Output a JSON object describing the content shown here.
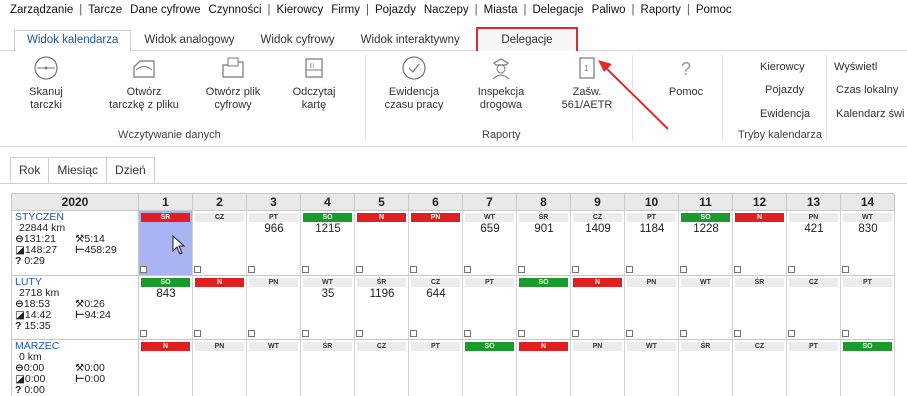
{
  "menubar": {
    "items": [
      "Zarządzanie",
      "Tarcze",
      "Dane cyfrowe",
      "Czynności",
      "Kierowcy",
      "Firmy",
      "Pojazdy",
      "Naczepy",
      "Miasta",
      "Delegacje",
      "Paliwo",
      "Raporty",
      "Pomoc"
    ]
  },
  "ribbon_tabs": [
    "Widok kalendarza",
    "Widok analogowy",
    "Widok cyfrowy",
    "Widok interaktywny",
    "Delegacje"
  ],
  "ribbon": {
    "buttons": [
      {
        "label1": "Skanuj",
        "label2": "tarczki",
        "icon": "scan-disc-icon"
      },
      {
        "label1": "Otwórz",
        "label2": "tarczkę z pliku",
        "icon": "open-disc-icon"
      },
      {
        "label1": "Otwórz plik",
        "label2": "cyfrowy",
        "icon": "open-file-icon"
      },
      {
        "label1": "Odczytaj",
        "label2": "kartę",
        "icon": "card-reader-icon"
      },
      {
        "label1": "Ewidencja",
        "label2": "czasu pracy",
        "icon": "clock-check-icon"
      },
      {
        "label1": "Inspekcja",
        "label2": "drogowa",
        "icon": "police-officer-icon"
      },
      {
        "label1": "Zašw.",
        "label2": "561/AETR",
        "icon": "document-1-icon"
      },
      {
        "label1": "Pomoc",
        "label2": "",
        "icon": "help-icon"
      }
    ],
    "groups": {
      "read": "Wczytywanie danych",
      "reports": "Raporty",
      "modes": "Tryby kalendarza"
    },
    "modes": [
      "Kierowcy",
      "Pojazdy",
      "Ewidencja"
    ],
    "display": [
      "Wyświetl",
      "Czas lokalny",
      "Kalendarz świ"
    ]
  },
  "view_tabs": [
    "Rok",
    "Miesiąc",
    "Dzień"
  ],
  "calendar": {
    "year": "2020",
    "days": [
      "1",
      "2",
      "3",
      "4",
      "5",
      "6",
      "7",
      "8",
      "9",
      "10",
      "11",
      "12",
      "13",
      "14"
    ],
    "months": [
      {
        "name": "STYCZEŃ",
        "km": "22844 km",
        "drive": "131:21",
        "work": "5:14",
        "other": "148:27",
        "rest": "458:29",
        "unknown": "0:29",
        "day_names": [
          "ŚR",
          "CZ",
          "PT",
          "SO",
          "N",
          "PN",
          "WT",
          "ŚR",
          "CZ",
          "PT",
          "SO",
          "N",
          "PN",
          "WT"
        ],
        "day_colors": [
          "red",
          "gray",
          "gray",
          "green",
          "red",
          "red",
          "gray",
          "gray",
          "gray",
          "gray",
          "green",
          "red",
          "gray",
          "gray"
        ],
        "values": [
          "",
          "",
          "966",
          "1215",
          "",
          "",
          "659",
          "901",
          "1409",
          "1184",
          "1228",
          "",
          "421",
          "830"
        ]
      },
      {
        "name": "LUTY",
        "km": "2718 km",
        "drive": "18:53",
        "work": "0:26",
        "other": "14:42",
        "rest": "94:24",
        "unknown": "15:35",
        "day_names": [
          "SO",
          "N",
          "PN",
          "WT",
          "ŚR",
          "CZ",
          "PT",
          "SO",
          "N",
          "PN",
          "WT",
          "ŚR",
          "CZ",
          "PT"
        ],
        "day_colors": [
          "green",
          "red",
          "gray",
          "gray",
          "gray",
          "gray",
          "gray",
          "green",
          "red",
          "gray",
          "gray",
          "gray",
          "gray",
          "gray"
        ],
        "values": [
          "843",
          "",
          "",
          "35",
          "1196",
          "644",
          "",
          "",
          "",
          "",
          "",
          "",
          "",
          ""
        ]
      },
      {
        "name": "MARZEC",
        "km": "0 km",
        "drive": "0:00",
        "work": "0:00",
        "other": "0:00",
        "rest": "0:00",
        "unknown": "0:00",
        "day_names": [
          "N",
          "PN",
          "WT",
          "ŚR",
          "CZ",
          "PT",
          "SO",
          "N",
          "PN",
          "WT",
          "ŚR",
          "CZ",
          "PT",
          "SO"
        ],
        "day_colors": [
          "red",
          "gray",
          "gray",
          "gray",
          "gray",
          "gray",
          "green",
          "red",
          "gray",
          "gray",
          "gray",
          "gray",
          "gray",
          "green"
        ],
        "values": [
          "",
          "",
          "",
          "",
          "",
          "",
          "",
          "",
          "",
          "",
          "",
          "",
          "",
          ""
        ]
      }
    ]
  },
  "colors": {
    "accent": "#1a56a8",
    "highlight": "#e0282e",
    "weekend_red": "#e02020",
    "weekend_green": "#1a9a2a",
    "selected": "#aab3f3"
  }
}
